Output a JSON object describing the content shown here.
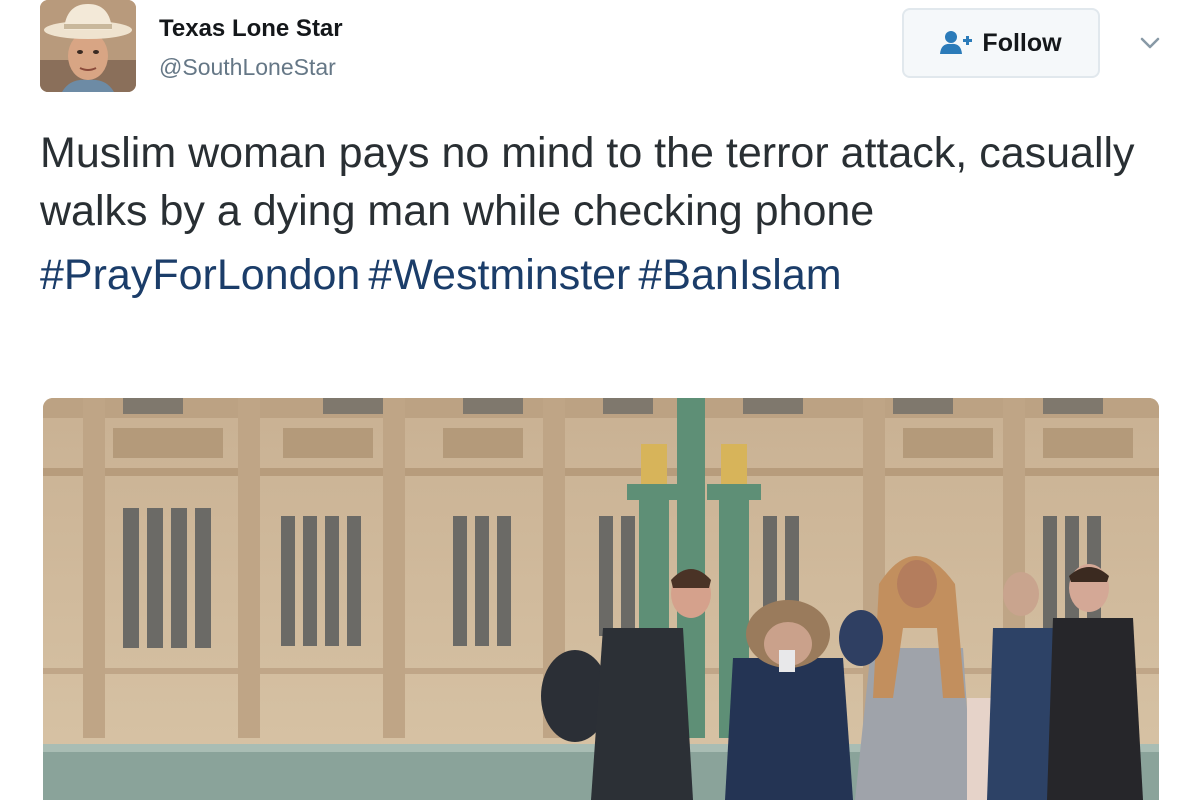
{
  "author": {
    "display_name": "Texas Lone Star",
    "handle": "@SouthLoneStar"
  },
  "follow_button": {
    "label": "Follow",
    "icon": "add-user-icon"
  },
  "menu": {
    "icon": "chevron-down-icon"
  },
  "tweet": {
    "text": "Muslim woman pays no mind to the terror attack, casually walks by a dying man while checking phone",
    "hashtags": [
      "#PrayForLondon",
      "#Westminster",
      "#BanIslam"
    ]
  },
  "media": {
    "alt_kind": "photo"
  },
  "colors": {
    "hashtag": "#1b3d69",
    "text": "#292f33",
    "secondary": "#657786",
    "button_border": "#e1e8ed"
  }
}
